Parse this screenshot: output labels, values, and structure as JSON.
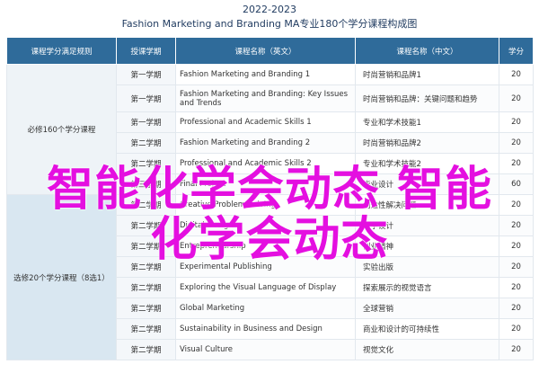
{
  "header": {
    "year": "2022-2023",
    "title": "Fashion Marketing and Branding MA专业180个学分课程构成图"
  },
  "table": {
    "headers": [
      "课程学分满足规则",
      "授课学期",
      "课程名称（英文）",
      "课程名称（中文）",
      "学分"
    ],
    "groups": [
      {
        "label": "必修160个学分课程",
        "rows": [
          {
            "term": "第一学期",
            "en": "Fashion Marketing and Branding 1",
            "cn": "时尚营销和品牌1",
            "credit": "20"
          },
          {
            "term": "第一学期",
            "en": "Fashion Marketing and Branding: Key Issues and Trends",
            "cn": "时尚营销和品牌：关键问题和趋势",
            "credit": "20"
          },
          {
            "term": "第一学期",
            "en": "Professional and Academic Skills 1",
            "cn": "专业和学术技能1",
            "credit": "20"
          },
          {
            "term": "第二学期",
            "en": "Fashion Marketing and Branding 2",
            "cn": "时尚营销和品牌2",
            "credit": "20"
          },
          {
            "term": "第二学期",
            "en": "Professional and Academic Skills 2",
            "cn": "专业和学术技能2",
            "credit": "20"
          },
          {
            "term": "第三学期",
            "en": "Final Project",
            "cn": "毕业设计",
            "credit": "60"
          }
        ]
      },
      {
        "label": "选修20个学分课程（8选1）",
        "rows": [
          {
            "term": "第二学期",
            "en": "Creative Problem Solving",
            "cn": "创造性解决问题",
            "credit": "20"
          },
          {
            "term": "第二学期",
            "en": "Digital Design",
            "cn": "数字设计",
            "credit": "20"
          },
          {
            "term": "第二学期",
            "en": "Entrepreneurship",
            "cn": "创业精神",
            "credit": "20"
          },
          {
            "term": "第二学期",
            "en": "Experimental Publishing",
            "cn": "实验出版",
            "credit": "20"
          },
          {
            "term": "第二学期",
            "en": "Exploring the Visual Language of Display",
            "cn": "探索展示的视觉语言",
            "credit": "20"
          },
          {
            "term": "第二学期",
            "en": "Global Marketing",
            "cn": "全球营销",
            "credit": "20"
          },
          {
            "term": "第二学期",
            "en": "Sustainability in Business and Design",
            "cn": "商业和设计的可持续性",
            "credit": "20"
          },
          {
            "term": "第二学期",
            "en": "Visual Culture",
            "cn": "视觉文化",
            "credit": "20"
          }
        ]
      }
    ]
  },
  "watermark": {
    "line1": "智能化学会动态 智能",
    "line2": "化学会动态",
    "color": "#e40fe0"
  },
  "colors": {
    "header_bg": "#2f6b9a",
    "title": "#1f3a5f"
  }
}
